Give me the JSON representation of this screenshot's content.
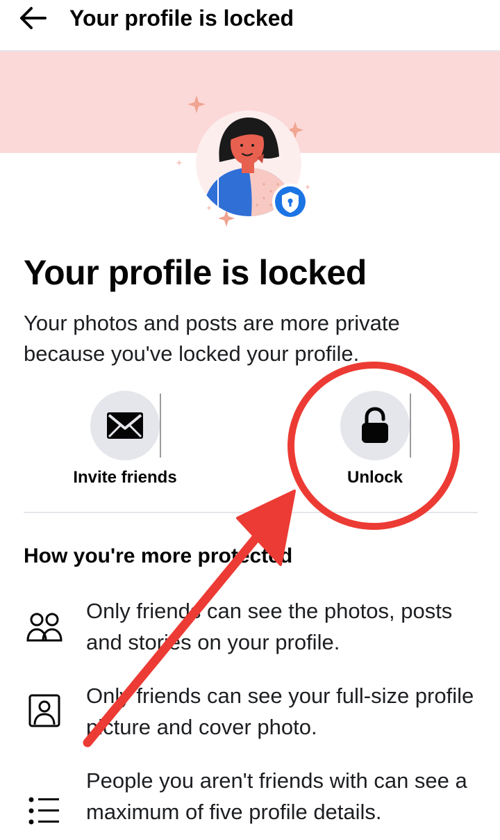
{
  "header": {
    "title": "Your profile is locked"
  },
  "main": {
    "title": "Your profile is locked",
    "description": "Your photos and posts are more private because you've locked your profile."
  },
  "actions": [
    {
      "label": "Invite friends",
      "icon": "envelope-icon"
    },
    {
      "label": "Unlock",
      "icon": "padlock-open-icon"
    }
  ],
  "protection": {
    "title": "How you're more protected",
    "items": [
      {
        "icon": "friends-icon",
        "text": "Only friends can see the photos, posts and stories on your profile."
      },
      {
        "icon": "profile-picture-icon",
        "text": "Only friends can see your full-size profile picture and cover photo."
      },
      {
        "icon": "list-icon",
        "text": "People you aren't friends with can see a maximum of five profile details."
      }
    ]
  },
  "colors": {
    "hero_band": "#fbd9d8",
    "accent_blue": "#1b74e4",
    "annotation_red": "#ec3b34"
  }
}
